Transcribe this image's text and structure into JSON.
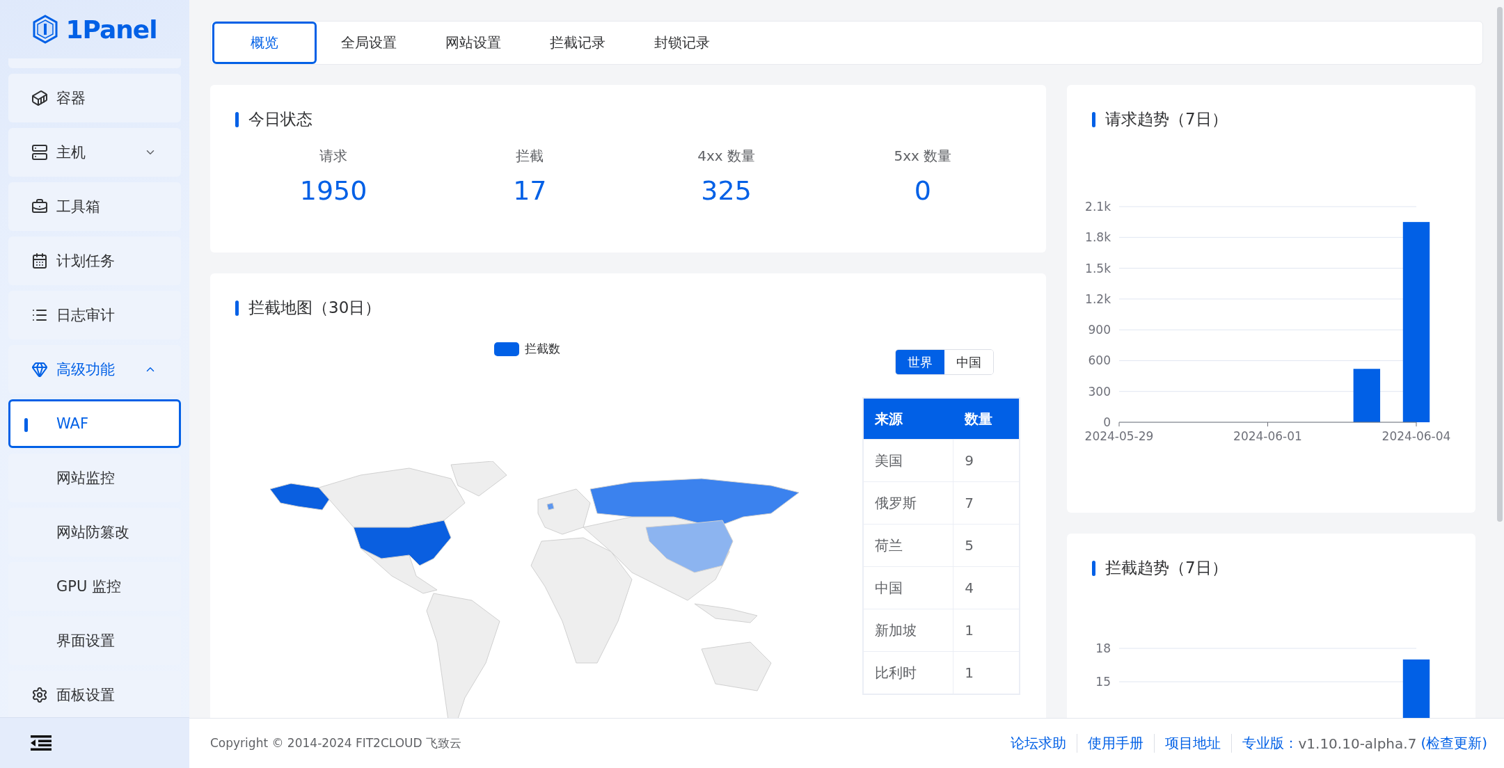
{
  "sidebar": {
    "logo": "1Panel",
    "items": [
      {
        "label": "容器"
      },
      {
        "label": "主机",
        "expanded": false
      },
      {
        "label": "工具箱"
      },
      {
        "label": "计划任务"
      },
      {
        "label": "日志审计"
      },
      {
        "label": "高级功能",
        "expanded": true,
        "children": [
          {
            "label": "WAF",
            "selected": true
          },
          {
            "label": "网站监控",
            "selected": false
          },
          {
            "label": "网站防篡改",
            "selected": false
          },
          {
            "label": "GPU 监控",
            "selected": false
          },
          {
            "label": "界面设置",
            "selected": false
          }
        ]
      },
      {
        "label": "面板设置"
      }
    ]
  },
  "tabs": [
    {
      "label": "概览",
      "selected": true
    },
    {
      "label": "全局设置",
      "selected": false
    },
    {
      "label": "网站设置",
      "selected": false
    },
    {
      "label": "拦截记录",
      "selected": false
    },
    {
      "label": "封锁记录",
      "selected": false
    }
  ],
  "today": {
    "title": "今日状态",
    "stats": [
      {
        "label": "请求",
        "value": "1950"
      },
      {
        "label": "拦截",
        "value": "17"
      },
      {
        "label": "4xx 数量",
        "value": "325"
      },
      {
        "label": "5xx 数量",
        "value": "0"
      }
    ]
  },
  "block_map": {
    "title": "拦截地图（30日）",
    "legend": "拦截数",
    "scope": [
      {
        "label": "世界",
        "selected": true
      },
      {
        "label": "中国",
        "selected": false
      }
    ],
    "table": {
      "columns": [
        "来源",
        "数量"
      ],
      "rows": [
        [
          "美国",
          "9"
        ],
        [
          "俄罗斯",
          "7"
        ],
        [
          "荷兰",
          "5"
        ],
        [
          "中国",
          "4"
        ],
        [
          "新加坡",
          "1"
        ],
        [
          "比利时",
          "1"
        ]
      ]
    }
  },
  "request_trend": {
    "title": "请求趋势（7日）",
    "chart_data": {
      "type": "bar",
      "x": [
        "2024-06-03",
        "2024-06-04"
      ],
      "grid": true,
      "series": [
        {
          "color": "#0160e6",
          "values": [
            520,
            1950
          ]
        }
      ],
      "ylim": [
        0,
        2100
      ],
      "yticks": [
        {
          "value": 0,
          "label": "0"
        },
        {
          "value": 300,
          "label": "300"
        },
        {
          "value": 600,
          "label": "600"
        },
        {
          "value": 900,
          "label": "900"
        },
        {
          "value": 1200,
          "label": "1.2k"
        },
        {
          "value": 1500,
          "label": "1.5k"
        },
        {
          "value": 1800,
          "label": "1.8k"
        },
        {
          "value": 2100,
          "label": "2.1k"
        }
      ],
      "xticks": [
        "2024-05-29",
        "2024-06-01",
        "2024-06-04"
      ],
      "xlim": [
        "2024-05-29",
        "2024-06-04"
      ]
    }
  },
  "block_trend": {
    "title": "拦截趋势（7日）",
    "chart_data": {
      "type": "bar",
      "grid": true,
      "series": [
        {
          "color": "#0160e6",
          "values": [
            17
          ]
        }
      ],
      "ylim": [
        0,
        18
      ],
      "yticks": [
        15,
        18
      ]
    }
  },
  "footer": {
    "copyright": "Copyright © 2014-2024 FIT2CLOUD 飞致云",
    "links": [
      "论坛求助",
      "使用手册",
      "项目地址"
    ],
    "edition": "专业版：",
    "version": "v1.10.10-alpha.7",
    "update": "(检查更新)"
  }
}
